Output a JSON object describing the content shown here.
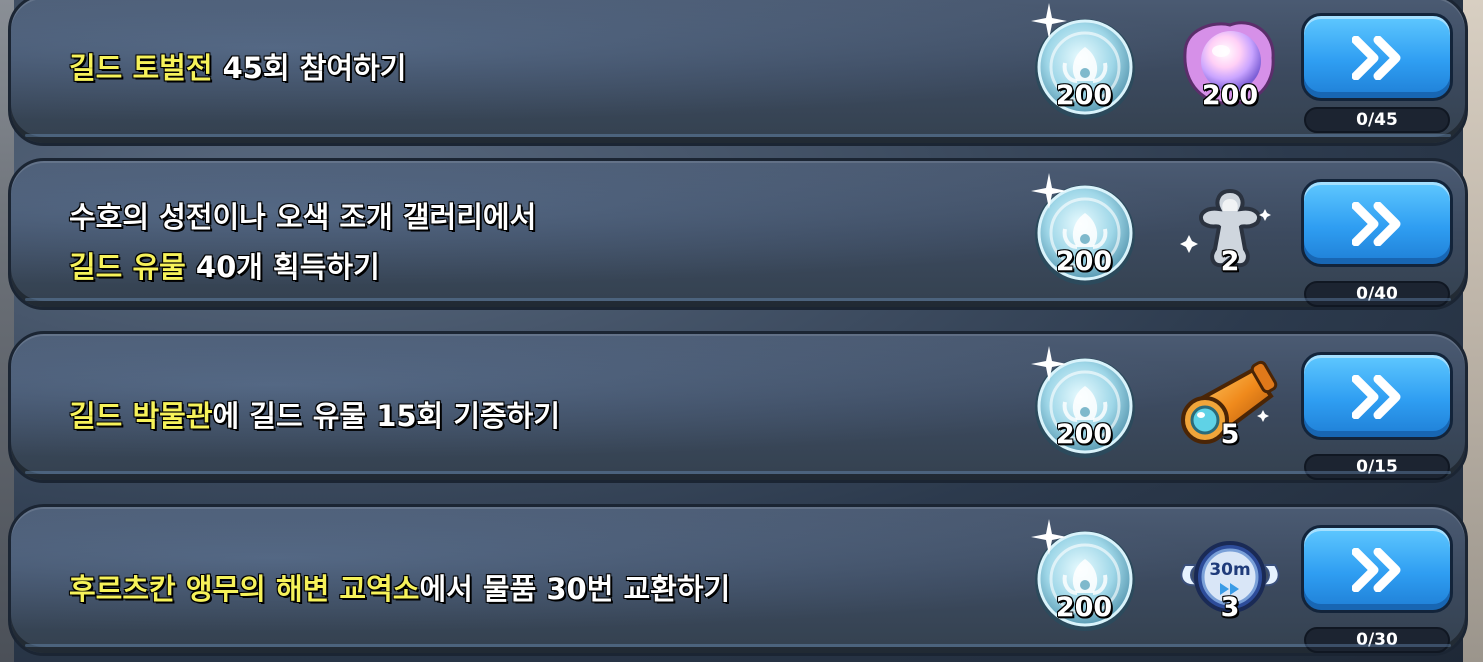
{
  "quests": [
    {
      "text_parts": [
        {
          "t": "길드 토벌전",
          "hl": true
        },
        {
          "t": " 45회 참여하기",
          "hl": false
        }
      ],
      "rewards": [
        {
          "icon": "guild-coin-icon",
          "count": "200"
        },
        {
          "icon": "rainbow-pearl-icon",
          "count": "200"
        }
      ],
      "progress": "0/45"
    },
    {
      "line1": "수호의 성전이나 오색 조개 갤러리에서",
      "text_parts": [
        {
          "t": "길드 유물",
          "hl": true
        },
        {
          "t": " 40개 획득하기",
          "hl": false
        }
      ],
      "rewards": [
        {
          "icon": "guild-coin-icon",
          "count": "200"
        },
        {
          "icon": "silver-cookie-cutter-icon",
          "count": "2"
        }
      ],
      "progress": "0/40"
    },
    {
      "text_parts": [
        {
          "t": "길드 박물관",
          "hl": true
        },
        {
          "t": "에 길드 유물 15회 기증하기",
          "hl": false
        }
      ],
      "rewards": [
        {
          "icon": "guild-coin-icon",
          "count": "200"
        },
        {
          "icon": "golden-spyglass-icon",
          "count": "5"
        }
      ],
      "progress": "0/15"
    },
    {
      "text_parts": [
        {
          "t": "후르츠칸 앵무의 해변 교역소",
          "hl": true
        },
        {
          "t": "에서 물품 30번 교환하기",
          "hl": false
        }
      ],
      "rewards": [
        {
          "icon": "guild-coin-icon",
          "count": "200"
        },
        {
          "icon": "speedup-30m-icon",
          "count": "3",
          "label": "30m"
        }
      ],
      "progress": "0/30"
    }
  ],
  "go_button": {
    "icon": "double-chevron-right-icon"
  },
  "colors": {
    "highlight": "#f6f25a",
    "button": "#2f9ef2",
    "panel": "#3c4a5f"
  }
}
